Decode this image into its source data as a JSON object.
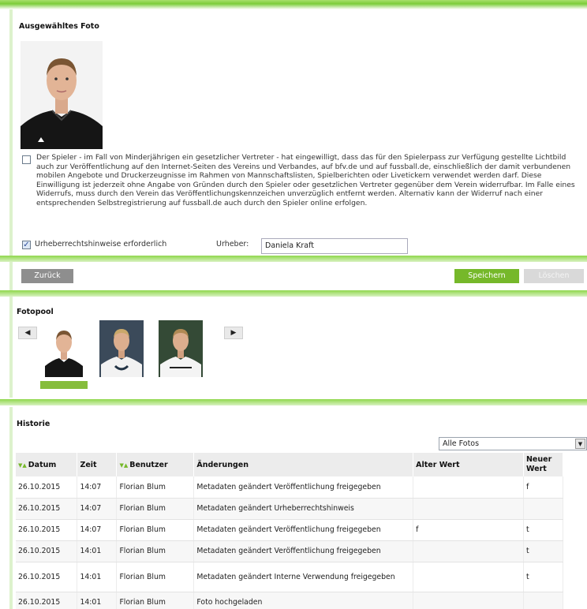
{
  "foto_section": {
    "title": "Ausgewähltes Foto",
    "consent_text": "Der Spieler - im Fall von Minderjährigen ein gesetzlicher Vertreter - hat eingewilligt, dass das für den Spielerpass zur Verfügung gestellte Lichtbild auch zur Veröffentlichung auf den Internet-Seiten des Vereins und Verbandes, auf bfv.de und auf fussball.de, einschließlich der damit verbundenen mobilen Angebote und Druckerzeugnisse im Rahmen von Mannschaftslisten, Spielberichten oder Livetickern verwendet werden darf. Diese Einwilligung ist jederzeit ohne Angabe von Gründen durch den Spieler oder gesetzlichen Vertreter gegenüber dem Verein widerrufbar. Im Falle eines Widerrufs, muss durch den Verein das Veröffentlichungskennzeichen unverzüglich entfernt werden. Alternativ kann der Widerruf nach einer entsprechenden Selbstregistrierung auf fussball.de auch durch den Spieler online erfolgen.",
    "consent_checked": false,
    "copyright_label": "Urheberrechtshinweise erforderlich",
    "copyright_checked": true,
    "urheber_label": "Urheber:",
    "urheber_value": "Daniela Kraft"
  },
  "buttons": {
    "back": "Zurück",
    "save": "Speichern",
    "delete": "Löschen"
  },
  "fotopool": {
    "title": "Fotopool",
    "prev_icon": "arrow-left-icon",
    "next_icon": "arrow-right-icon"
  },
  "historie": {
    "title": "Historie",
    "filter_value": "Alle Fotos",
    "columns": [
      "Datum",
      "Zeit",
      "Benutzer",
      "Änderungen",
      "Alter Wert",
      "Neuer Wert"
    ],
    "rows": [
      {
        "datum": "26.10.2015",
        "zeit": "14:07",
        "benutzer": "Florian Blum",
        "aenderung": "Metadaten geändert Veröffentlichung freigegeben",
        "alt": "",
        "neu": "f"
      },
      {
        "datum": "26.10.2015",
        "zeit": "14:07",
        "benutzer": "Florian Blum",
        "aenderung": "Metadaten geändert Urheberrechtshinweis",
        "alt": "",
        "neu": ""
      },
      {
        "datum": "26.10.2015",
        "zeit": "14:07",
        "benutzer": "Florian Blum",
        "aenderung": "Metadaten geändert Veröffentlichung freigegeben",
        "alt": "f",
        "neu": "t"
      },
      {
        "datum": "26.10.2015",
        "zeit": "14:01",
        "benutzer": "Florian Blum",
        "aenderung": "Metadaten geändert Veröffentlichung freigegeben",
        "alt": "",
        "neu": "t"
      },
      {
        "datum": "26.10.2015",
        "zeit": "14:01",
        "benutzer": "Florian Blum",
        "aenderung": "Metadaten geändert Interne Verwendung freigegeben",
        "alt": "",
        "neu": "t"
      },
      {
        "datum": "26.10.2015",
        "zeit": "14:01",
        "benutzer": "Florian Blum",
        "aenderung": "Foto hochgeladen",
        "alt": "",
        "neu": ""
      }
    ]
  },
  "colors": {
    "accent_green": "#76b82a",
    "button_grey": "#8e8e8e"
  }
}
